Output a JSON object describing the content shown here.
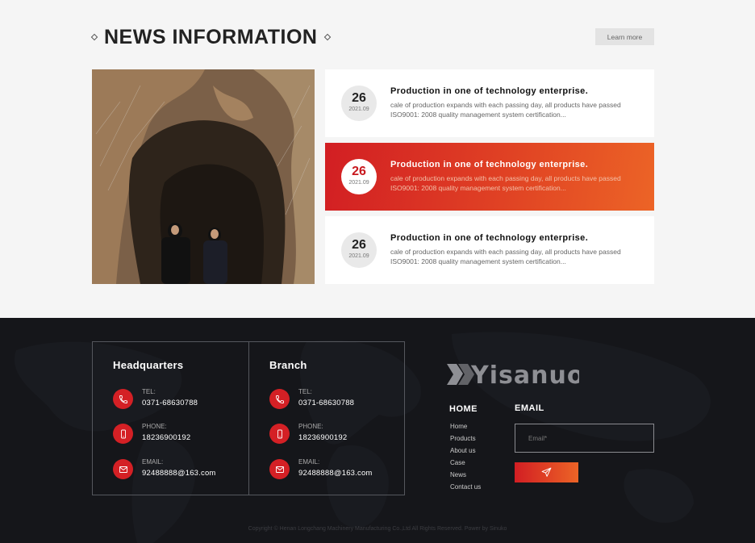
{
  "news": {
    "title": "NEWS INFORMATION",
    "learn_more": "Learn more",
    "items": [
      {
        "day": "26",
        "ym": "2021.09",
        "title": "Production in one of technology enterprise.",
        "desc": "cale of production expands with each passing day, all products have passed ISO9001: 2008 quality management system certification..."
      },
      {
        "day": "26",
        "ym": "2021.09",
        "title": "Production in one of technology enterprise.",
        "desc": "cale of production expands with each passing day, all products have passed ISO9001: 2008 quality management system certification..."
      },
      {
        "day": "26",
        "ym": "2021.09",
        "title": "Production in one of technology enterprise.",
        "desc": "cale of production expands with each passing day, all products have passed ISO9001: 2008 quality management system certification..."
      }
    ]
  },
  "footer": {
    "headquarters": {
      "title": "Headquarters",
      "tel_label": "TEL:",
      "tel": "0371-68630788",
      "phone_label": "PHONE:",
      "phone": "18236900192",
      "email_label": "EMAIL:",
      "email": "92488888@163.com"
    },
    "branch": {
      "title": "Branch",
      "tel_label": "TEL:",
      "tel": "0371-68630788",
      "phone_label": "PHONE:",
      "phone": "18236900192",
      "email_label": "EMAIL:",
      "email": "92488888@163.com"
    },
    "logo_text": "Yisanuo",
    "home_title": "HOME",
    "home_links": [
      "Home",
      "Products",
      "About us",
      "Case",
      "News",
      "Contact us"
    ],
    "email_title": "EMAIL",
    "email_placeholder": "Email*",
    "copyright": "Copyright © Henan Longchang Machinery Manufacturing Co.,Ltd All Rights Reserved. Power by Sinuko"
  },
  "colors": {
    "accent_red": "#d21e23",
    "accent_orange": "#ec6426",
    "footer_bg": "#15161a"
  }
}
